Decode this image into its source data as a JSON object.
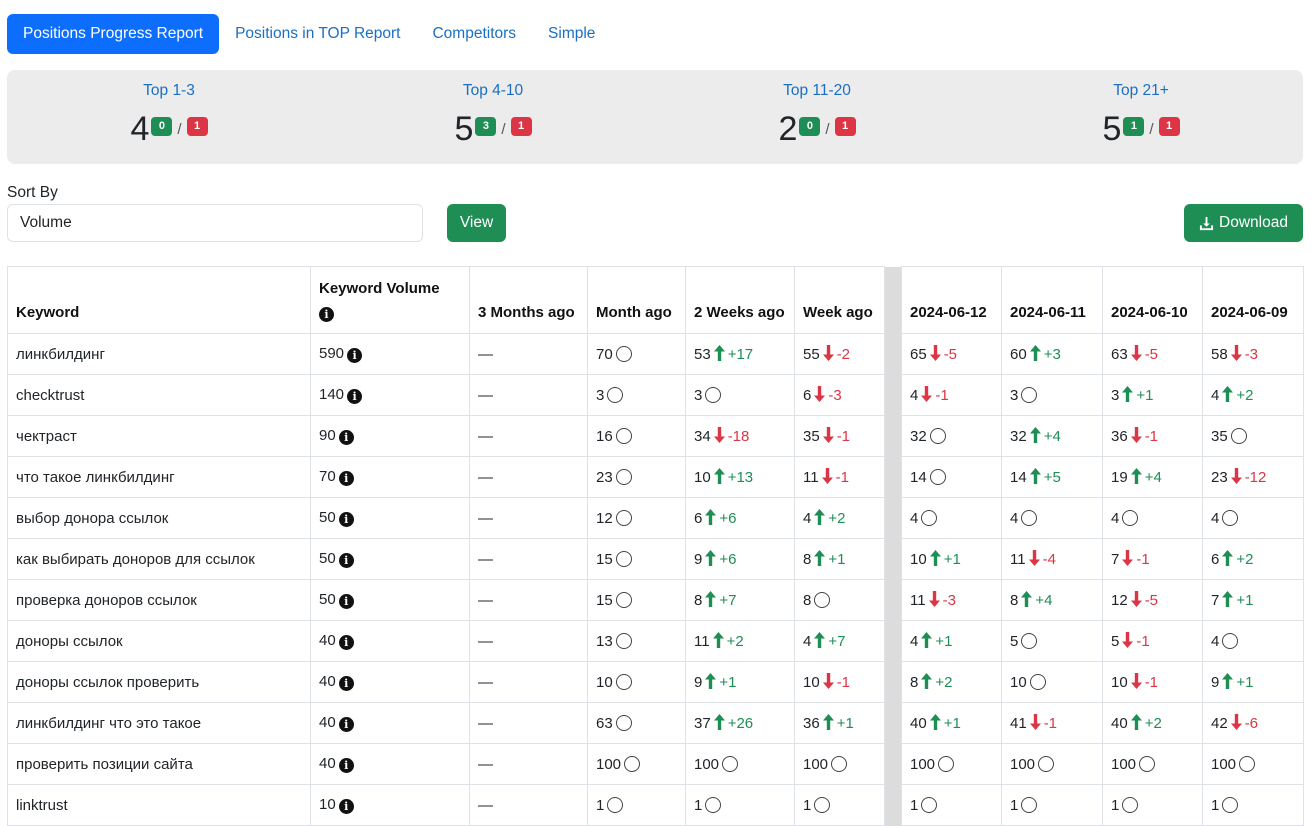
{
  "tabs": [
    "Positions Progress Report",
    "Positions in TOP Report",
    "Competitors",
    "Simple"
  ],
  "summary": [
    {
      "title": "Top 1-3",
      "count": "4",
      "up": "0",
      "down": "1"
    },
    {
      "title": "Top 4-10",
      "count": "5",
      "up": "3",
      "down": "1"
    },
    {
      "title": "Top 11-20",
      "count": "2",
      "up": "0",
      "down": "1"
    },
    {
      "title": "Top 21+",
      "count": "5",
      "up": "1",
      "down": "1"
    }
  ],
  "summary_slash": "/",
  "sort": {
    "label": "Sort By",
    "value": "Volume"
  },
  "buttons": {
    "view": "View",
    "download": "Download"
  },
  "table": {
    "headers": [
      "Keyword",
      "Keyword Volume",
      "3 Months ago",
      "Month ago",
      "2 Weeks ago",
      "Week ago",
      "2024-06-12",
      "2024-06-11",
      "2024-06-10",
      "2024-06-09"
    ],
    "empty_marker": "—",
    "rows": [
      {
        "keyword": "линкбилдинг",
        "volume": "590",
        "m3": "—",
        "cells": [
          [
            "70",
            "",
            ""
          ],
          [
            "53",
            "up",
            "+17"
          ],
          [
            "55",
            "down",
            "-2"
          ],
          [
            "65",
            "down",
            "-5"
          ],
          [
            "60",
            "up",
            "+3"
          ],
          [
            "63",
            "down",
            "-5"
          ],
          [
            "58",
            "down",
            "-3"
          ]
        ]
      },
      {
        "keyword": "checktrust",
        "volume": "140",
        "m3": "—",
        "cells": [
          [
            "3",
            "",
            ""
          ],
          [
            "3",
            "",
            ""
          ],
          [
            "6",
            "down",
            "-3"
          ],
          [
            "4",
            "down",
            "-1"
          ],
          [
            "3",
            "",
            ""
          ],
          [
            "3",
            "up",
            "+1"
          ],
          [
            "4",
            "up",
            "+2"
          ]
        ]
      },
      {
        "keyword": "чектраст",
        "volume": "90",
        "m3": "—",
        "cells": [
          [
            "16",
            "",
            ""
          ],
          [
            "34",
            "down",
            "-18"
          ],
          [
            "35",
            "down",
            "-1"
          ],
          [
            "32",
            "",
            ""
          ],
          [
            "32",
            "up",
            "+4"
          ],
          [
            "36",
            "down",
            "-1"
          ],
          [
            "35",
            "",
            ""
          ]
        ]
      },
      {
        "keyword": "что такое линкбилдинг",
        "volume": "70",
        "m3": "—",
        "cells": [
          [
            "23",
            "",
            ""
          ],
          [
            "10",
            "up",
            "+13"
          ],
          [
            "11",
            "down",
            "-1"
          ],
          [
            "14",
            "",
            ""
          ],
          [
            "14",
            "up",
            "+5"
          ],
          [
            "19",
            "up",
            "+4"
          ],
          [
            "23",
            "down",
            "-12"
          ]
        ]
      },
      {
        "keyword": "выбор донора ссылок",
        "volume": "50",
        "m3": "—",
        "cells": [
          [
            "12",
            "",
            ""
          ],
          [
            "6",
            "up",
            "+6"
          ],
          [
            "4",
            "up",
            "+2"
          ],
          [
            "4",
            "",
            ""
          ],
          [
            "4",
            "",
            ""
          ],
          [
            "4",
            "",
            ""
          ],
          [
            "4",
            "",
            ""
          ]
        ]
      },
      {
        "keyword": "как выбирать доноров для ссылок",
        "volume": "50",
        "m3": "—",
        "cells": [
          [
            "15",
            "",
            ""
          ],
          [
            "9",
            "up",
            "+6"
          ],
          [
            "8",
            "up",
            "+1"
          ],
          [
            "10",
            "up",
            "+1"
          ],
          [
            "11",
            "down",
            "-4"
          ],
          [
            "7",
            "down",
            "-1"
          ],
          [
            "6",
            "up",
            "+2"
          ]
        ]
      },
      {
        "keyword": "проверка доноров ссылок",
        "volume": "50",
        "m3": "—",
        "cells": [
          [
            "15",
            "",
            ""
          ],
          [
            "8",
            "up",
            "+7"
          ],
          [
            "8",
            "",
            ""
          ],
          [
            "11",
            "down",
            "-3"
          ],
          [
            "8",
            "up",
            "+4"
          ],
          [
            "12",
            "down",
            "-5"
          ],
          [
            "7",
            "up",
            "+1"
          ]
        ]
      },
      {
        "keyword": "доноры ссылок",
        "volume": "40",
        "m3": "—",
        "cells": [
          [
            "13",
            "",
            ""
          ],
          [
            "11",
            "up",
            "+2"
          ],
          [
            "4",
            "up",
            "+7"
          ],
          [
            "4",
            "up",
            "+1"
          ],
          [
            "5",
            "",
            ""
          ],
          [
            "5",
            "down",
            "-1"
          ],
          [
            "4",
            "",
            ""
          ]
        ]
      },
      {
        "keyword": "доноры ссылок проверить",
        "volume": "40",
        "m3": "—",
        "cells": [
          [
            "10",
            "",
            ""
          ],
          [
            "9",
            "up",
            "+1"
          ],
          [
            "10",
            "down",
            "-1"
          ],
          [
            "8",
            "up",
            "+2"
          ],
          [
            "10",
            "",
            ""
          ],
          [
            "10",
            "down",
            "-1"
          ],
          [
            "9",
            "up",
            "+1"
          ]
        ]
      },
      {
        "keyword": "линкбилдинг что это такое",
        "volume": "40",
        "m3": "—",
        "cells": [
          [
            "63",
            "",
            ""
          ],
          [
            "37",
            "up",
            "+26"
          ],
          [
            "36",
            "up",
            "+1"
          ],
          [
            "40",
            "up",
            "+1"
          ],
          [
            "41",
            "down",
            "-1"
          ],
          [
            "40",
            "up",
            "+2"
          ],
          [
            "42",
            "down",
            "-6"
          ]
        ]
      },
      {
        "keyword": "проверить позиции сайта",
        "volume": "40",
        "m3": "—",
        "cells": [
          [
            "100",
            "",
            ""
          ],
          [
            "100",
            "",
            ""
          ],
          [
            "100",
            "",
            ""
          ],
          [
            "100",
            "",
            ""
          ],
          [
            "100",
            "",
            ""
          ],
          [
            "100",
            "",
            ""
          ],
          [
            "100",
            "",
            ""
          ]
        ]
      },
      {
        "keyword": "linktrust",
        "volume": "10",
        "m3": "—",
        "cells": [
          [
            "1",
            "",
            ""
          ],
          [
            "1",
            "",
            ""
          ],
          [
            "1",
            "",
            ""
          ],
          [
            "1",
            "",
            ""
          ],
          [
            "1",
            "",
            ""
          ],
          [
            "1",
            "",
            ""
          ],
          [
            "1",
            "",
            ""
          ]
        ]
      }
    ]
  },
  "colors": {
    "primary": "#0d6efd",
    "success": "#1e8e55",
    "danger": "#dc3545",
    "link": "#1a6fc4",
    "panel": "#ececec"
  },
  "icons": {
    "info": "info-circle-icon",
    "same": "circle-outline-icon",
    "up": "arrow-up-icon",
    "down": "arrow-down-icon",
    "download": "download-icon"
  }
}
